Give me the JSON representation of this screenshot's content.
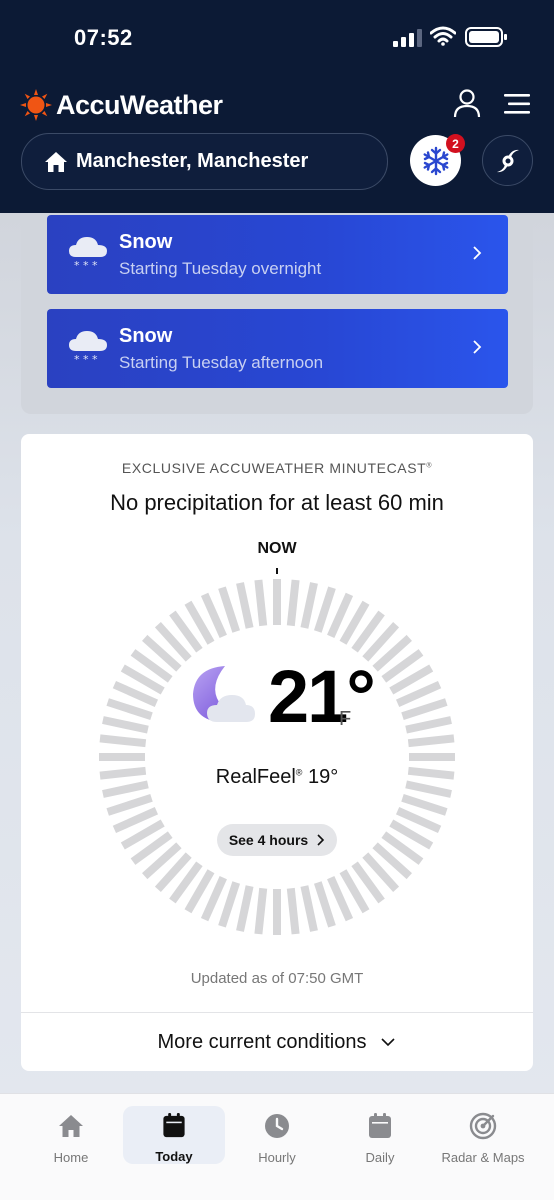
{
  "status_bar": {
    "time": "07:52"
  },
  "header": {
    "brand": "AccuWeather",
    "location": "Manchester, Manchester",
    "alert_count": "2"
  },
  "alerts": [
    {
      "title": "Snow",
      "subtitle": "Starting Tuesday overnight"
    },
    {
      "title": "Snow",
      "subtitle": "Starting Tuesday afternoon"
    }
  ],
  "minutecast": {
    "label": "EXCLUSIVE ACCUWEATHER MINUTECAST",
    "label_mark": "®",
    "summary": "No precipitation for at least 60 min",
    "now_label": "NOW",
    "temperature": "21°",
    "unit": "F",
    "realfeel_label": "RealFeel",
    "realfeel_mark": "®",
    "realfeel_value": " 19°",
    "see_hours": "See 4 hours",
    "updated": "Updated as of 07:50 GMT",
    "more_conditions": "More current conditions"
  },
  "nav": [
    {
      "label": "Home",
      "icon": "home-icon"
    },
    {
      "label": "Today",
      "icon": "calendar-today-icon",
      "active": true
    },
    {
      "label": "Hourly",
      "icon": "clock-icon"
    },
    {
      "label": "Daily",
      "icon": "calendar-icon"
    },
    {
      "label": "Radar & Maps",
      "icon": "radar-icon"
    }
  ],
  "colors": {
    "header_bg": "#0c1a35",
    "alert_blue": "#2847d4",
    "badge_red": "#d2101f",
    "brand_orange": "#f05514"
  }
}
